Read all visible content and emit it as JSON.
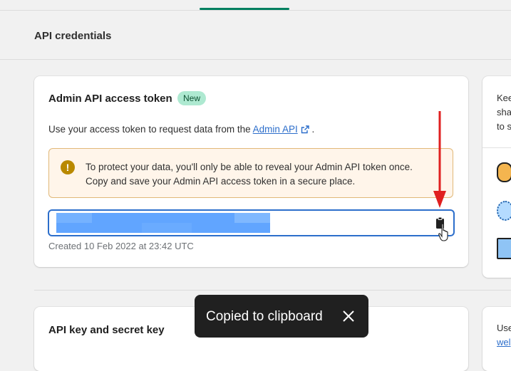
{
  "section": {
    "title": "API credentials"
  },
  "access_token_card": {
    "title": "Admin API access token",
    "badge": "New",
    "description_before": "Use your access token to request data from the",
    "description_link": "Admin API",
    "description_after": ".",
    "banner": {
      "icon": "exclamation-icon",
      "line1": "To protect your data, you'll only be able to reveal your Admin API token once.",
      "line2": "Copy and save your Admin API access token in a secure place."
    },
    "token_field": {
      "value_state": "redacted"
    },
    "created": "Created 10 Feb 2022 at 23:42 UTC"
  },
  "api_key_card": {
    "title": "API key and secret key"
  },
  "side_panel": {
    "lines": [
      "Kee",
      "sha",
      "to s"
    ],
    "bottom_text": "Use",
    "bottom_link": "wel"
  },
  "toast": {
    "message": "Copied to clipboard",
    "close_icon": "close-icon"
  },
  "colors": {
    "accent": "#008060",
    "link": "#2c6ecb",
    "badge_bg": "#aee9d1",
    "warning_bg": "#fff5ea",
    "warning_icon": "#b98900",
    "annotation": "#e02020",
    "toast_bg": "#202020"
  }
}
